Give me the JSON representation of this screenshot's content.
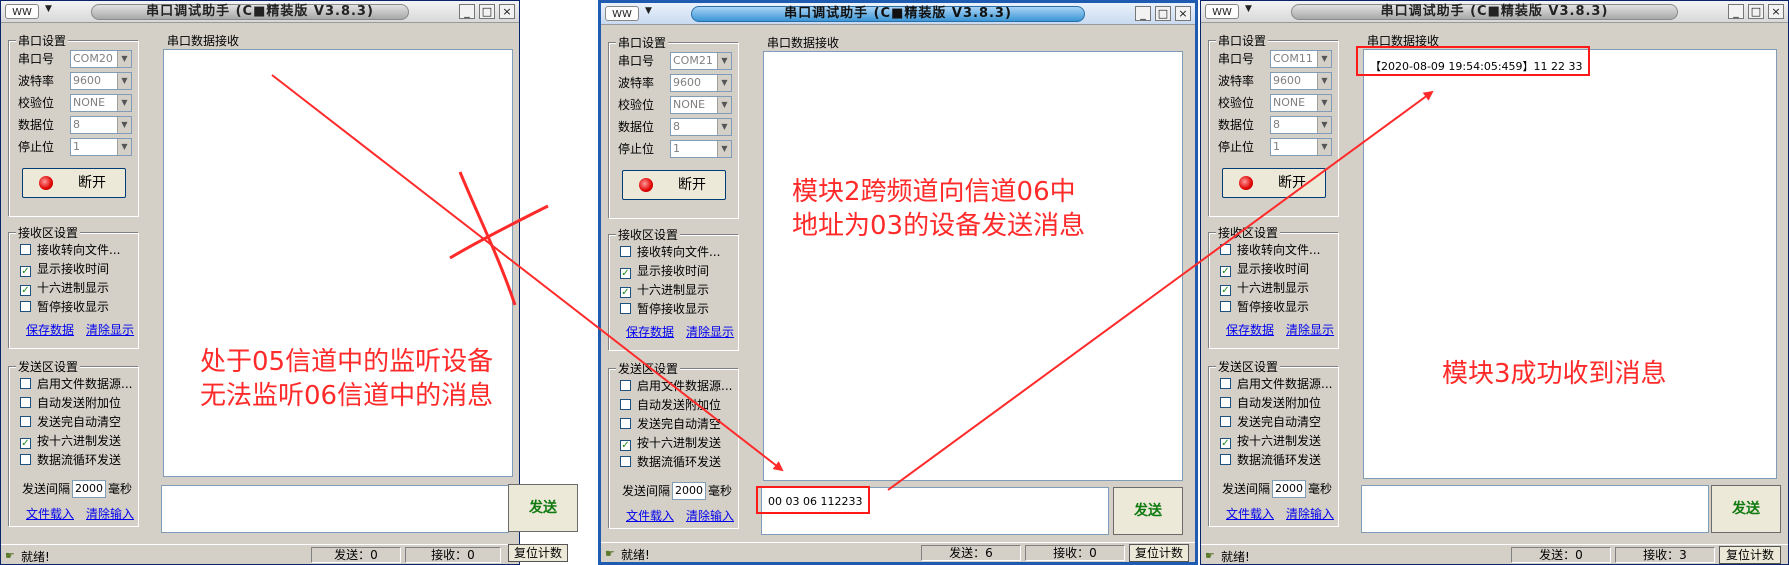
{
  "title": "串口调试助手 (C■精装版 V3.8.3)",
  "sysmenu_label": "WW",
  "settings": {
    "group_title": "串口设置",
    "port_label": "串口号",
    "baud_label": "波特率",
    "baud_value": "9600",
    "parity_label": "校验位",
    "parity_value": "NONE",
    "databits_label": "数据位",
    "databits_value": "8",
    "stopbits_label": "停止位",
    "stopbits_value": "1",
    "disconnect_label": "断开"
  },
  "receive_settings": {
    "group_title": "接收区设置",
    "options": [
      {
        "label": "接收转向文件...",
        "checked": false
      },
      {
        "label": "显示接收时间",
        "checked": true
      },
      {
        "label": "十六进制显示",
        "checked": true
      },
      {
        "label": "暂停接收显示",
        "checked": false
      }
    ],
    "save_link": "保存数据",
    "clear_link": "清除显示"
  },
  "send_settings": {
    "group_title": "发送区设置",
    "options": [
      {
        "label": "启用文件数据源...",
        "checked": false
      },
      {
        "label": "自动发送附加位",
        "checked": false
      },
      {
        "label": "发送完自动清空",
        "checked": false
      },
      {
        "label": "按十六进制发送",
        "checked": true
      },
      {
        "label": "数据流循环发送",
        "checked": false
      }
    ],
    "interval_label": "发送间隔",
    "interval_value": "2000",
    "interval_unit": "毫秒",
    "file_load_link": "文件载入",
    "clear_input_link": "清除输入"
  },
  "receive_area_label": "串口数据接收",
  "send_button": "发送",
  "status_ready": "就绪!",
  "reset_counter": "复位计数",
  "windows": [
    {
      "port": "COM20",
      "recv_text": "",
      "send_text": "",
      "sent": "发送：0",
      "received": "接收：0"
    },
    {
      "port": "COM21",
      "recv_text": "",
      "send_text": "00 03 06 112233",
      "sent": "发送：6",
      "received": "接收：0"
    },
    {
      "port": "COM11",
      "recv_text": "【2020-08-09 19:54:05:459】11 22 33",
      "send_text": "",
      "sent": "发送：0",
      "received": "接收：3"
    }
  ],
  "annotations": {
    "left_line1": "处于05信道中的监听设备",
    "left_line2": "无法监听06信道中的消息",
    "middle_line1": "模块2跨频道向信道06中",
    "middle_line2": "地址为03的设备发送消息",
    "right_line1": "模块3成功收到消息"
  },
  "colors": {
    "annotation_red": "#ff2a2a",
    "active_border": "#1f5bb0",
    "send_green": "#0f7a0f"
  }
}
